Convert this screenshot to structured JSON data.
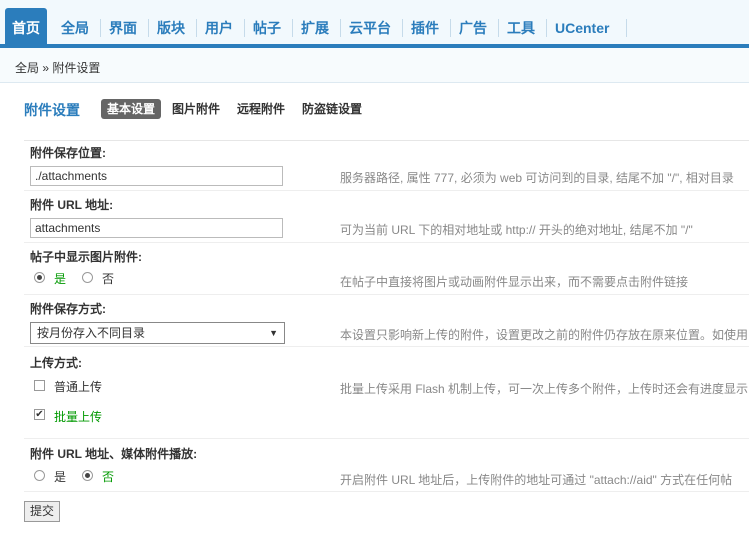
{
  "nav": {
    "items": [
      "首页",
      "全局",
      "界面",
      "版块",
      "用户",
      "帖子",
      "扩展",
      "云平台",
      "插件",
      "广告",
      "工具",
      "UCenter"
    ],
    "active_index": 0
  },
  "breadcrumb": {
    "text": "全局 » 附件设置"
  },
  "page": {
    "title": "附件设置",
    "tabs": [
      "基本设置",
      "图片附件",
      "远程附件",
      "防盗链设置"
    ],
    "active_tab": 0
  },
  "form": {
    "save_path": {
      "label": "附件保存位置:",
      "value": "./attachments",
      "tip": "服务器路径, 属性 777, 必须为 web 可访问到的目录, 结尾不加 \"/\", 相对目录"
    },
    "url": {
      "label": "附件 URL 地址:",
      "value": "attachments",
      "tip": "可为当前 URL 下的相对地址或 http:// 开头的绝对地址, 结尾不加 \"/\""
    },
    "show_image": {
      "label": "帖子中显示图片附件:",
      "yes": "是",
      "no": "否",
      "selected": "yes",
      "tip": "在帖子中直接将图片或动画附件显示出来，而不需要点击附件链接"
    },
    "save_mode": {
      "label": "附件保存方式:",
      "selected": "按月份存入不同目录",
      "tip": "本设置只影响新上传的附件，设置更改之前的附件仍存放在原来位置。如使用"
    },
    "upload_mode": {
      "label": "上传方式:",
      "normal": "普通上传",
      "batch": "批量上传",
      "normal_checked": false,
      "batch_checked": true,
      "tip": "批量上传采用 Flash 机制上传，可一次上传多个附件，上传时还会有进度显示"
    },
    "media": {
      "label": "附件 URL 地址、媒体附件播放:",
      "yes": "是",
      "no": "否",
      "selected": "no",
      "tip": "开启附件 URL 地址后，上传附件的地址可通过 \"attach://aid\" 方式在任何帖"
    }
  },
  "submit_label": "提交"
}
